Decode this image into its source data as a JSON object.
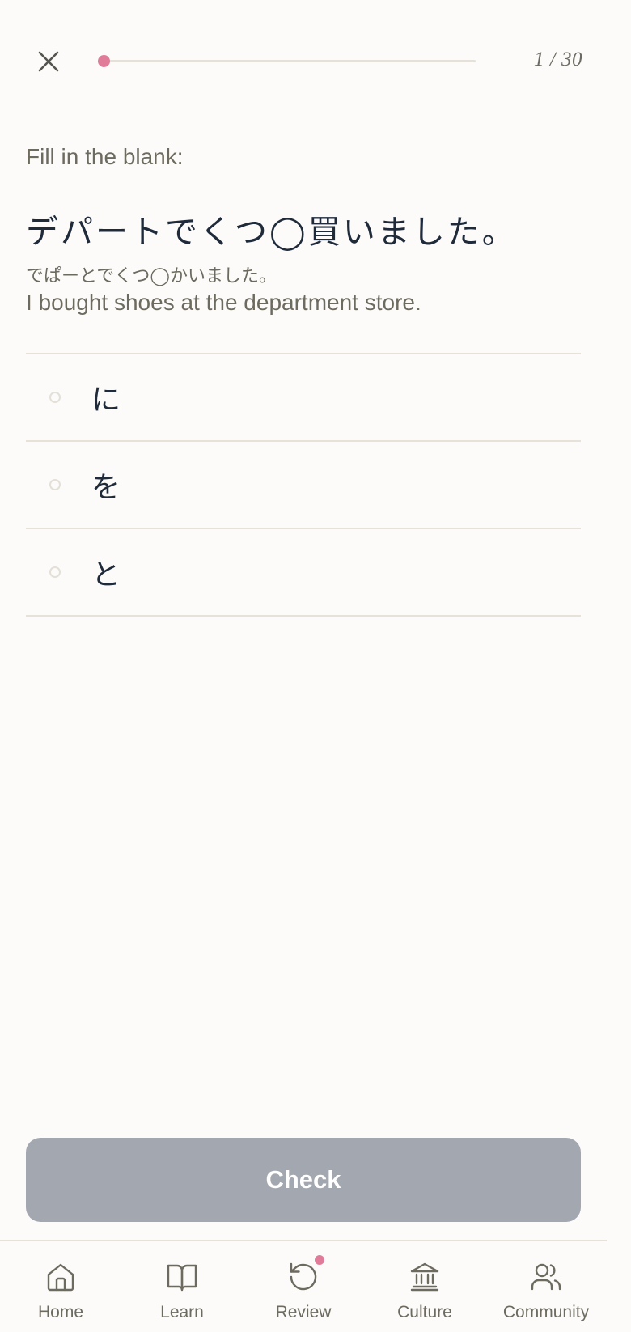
{
  "header": {
    "progress_counter": "1 / 30",
    "progress_fraction": 0.0
  },
  "question": {
    "prompt": "Fill in the blank:",
    "sentence": "デパートでくつ◯買いました。",
    "reading": "でぱーとでくつ◯かいました。",
    "translation": "I bought shoes at the department store."
  },
  "options": [
    {
      "label": "に"
    },
    {
      "label": "を"
    },
    {
      "label": "と"
    }
  ],
  "check_button": {
    "label": "Check"
  },
  "nav": {
    "items": [
      {
        "label": "Home",
        "icon": "home-icon"
      },
      {
        "label": "Learn",
        "icon": "book-icon"
      },
      {
        "label": "Review",
        "icon": "refresh-icon",
        "badge": true
      },
      {
        "label": "Culture",
        "icon": "landmark-icon"
      },
      {
        "label": "Community",
        "icon": "users-icon"
      }
    ]
  },
  "colors": {
    "accent": "#e07c9a",
    "button_disabled": "#a3a7b0",
    "background": "#fcfbf9",
    "text_primary": "#1f2a3a",
    "text_secondary": "#6d6b5f"
  }
}
